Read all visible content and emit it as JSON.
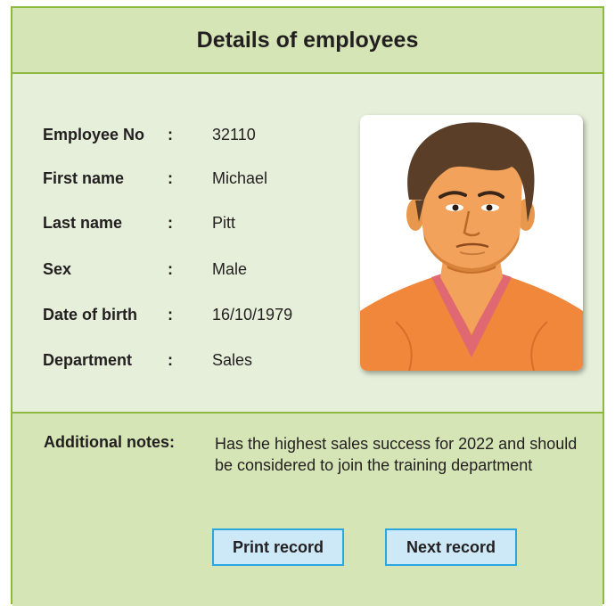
{
  "form": {
    "title": "Details of employees",
    "fields": [
      {
        "label": "Employee No",
        "colon": ":",
        "value": "32110"
      },
      {
        "label": "First name",
        "colon": ":",
        "value": "Michael"
      },
      {
        "label": "Last name",
        "colon": ":",
        "value": "Pitt"
      },
      {
        "label": "Sex",
        "colon": ":",
        "value": "Male"
      },
      {
        "label": "Date of birth",
        "colon": ":",
        "value": "16/10/1979"
      },
      {
        "label": "Department",
        "colon": ":",
        "value": "Sales"
      }
    ],
    "photo": {
      "icon": "employee-portrait"
    },
    "notes": {
      "label": "Additional notes:",
      "text": "Has the highest sales success for 2022 and should be considered to join the training department"
    },
    "buttons": {
      "print_label": "Print record",
      "next_label": "Next record"
    }
  },
  "colors": {
    "header_bg": "#d5e5b5",
    "body_bg": "#e5efd9",
    "border": "#8dba3e",
    "button_bg": "#cde9f7",
    "button_border": "#2aa7de"
  }
}
